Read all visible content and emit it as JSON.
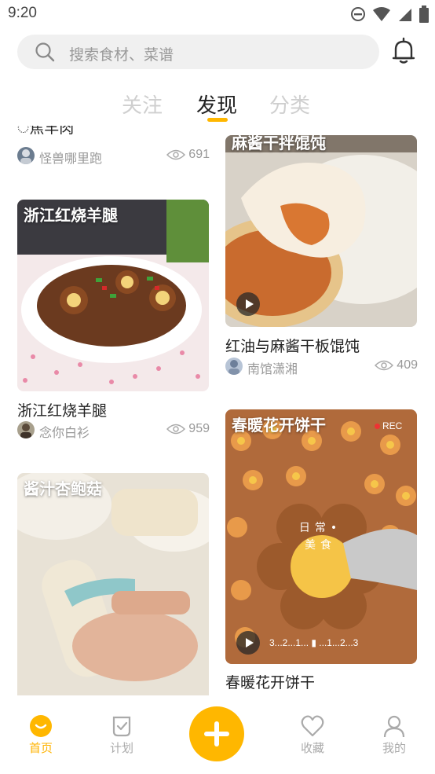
{
  "status_bar": {
    "time": "9:20"
  },
  "search": {
    "placeholder": "搜索食材、菜谱"
  },
  "tabs": [
    {
      "label": "关注",
      "active": false
    },
    {
      "label": "发现",
      "active": true
    },
    {
      "label": "分类",
      "active": false
    }
  ],
  "feed": {
    "left": [
      {
        "title": "浙江红烧羊腿",
        "overlay_title": "浙江红烧羊腿",
        "author": "念你白衫",
        "views": "959"
      },
      {
        "title": "",
        "overlay_title": "酱汁杏鲍菇",
        "author": "",
        "views": ""
      }
    ],
    "right": [
      {
        "title": "红油与麻酱干板馄饨",
        "overlay_title": "麻酱干拌馄饨",
        "author": "南馆潇湘",
        "views": "409",
        "video": true
      },
      {
        "title": "春暖花开饼干",
        "overlay_title": "春暖花开饼干",
        "author": "",
        "views": "",
        "video": true,
        "video_text": "3...2...1... ▮ ...1...2...3",
        "rec_text": "REC",
        "stamp_text": "日常•美食"
      }
    ],
    "partial_top_left": {
      "title": "ੋ焦羊肉",
      "author": "怪兽哪里跑",
      "views": "691"
    }
  },
  "colors": {
    "accent": "#ffb700",
    "inactive": "#aaaaaa",
    "text": "#222222"
  },
  "bottom_nav": [
    {
      "label": "首页",
      "icon": "home-icon",
      "active": true
    },
    {
      "label": "计划",
      "icon": "plan-icon",
      "active": false
    },
    {
      "label": "",
      "icon": "add-icon",
      "active": false
    },
    {
      "label": "收藏",
      "icon": "heart-icon",
      "active": false
    },
    {
      "label": "我的",
      "icon": "profile-icon",
      "active": false
    }
  ]
}
